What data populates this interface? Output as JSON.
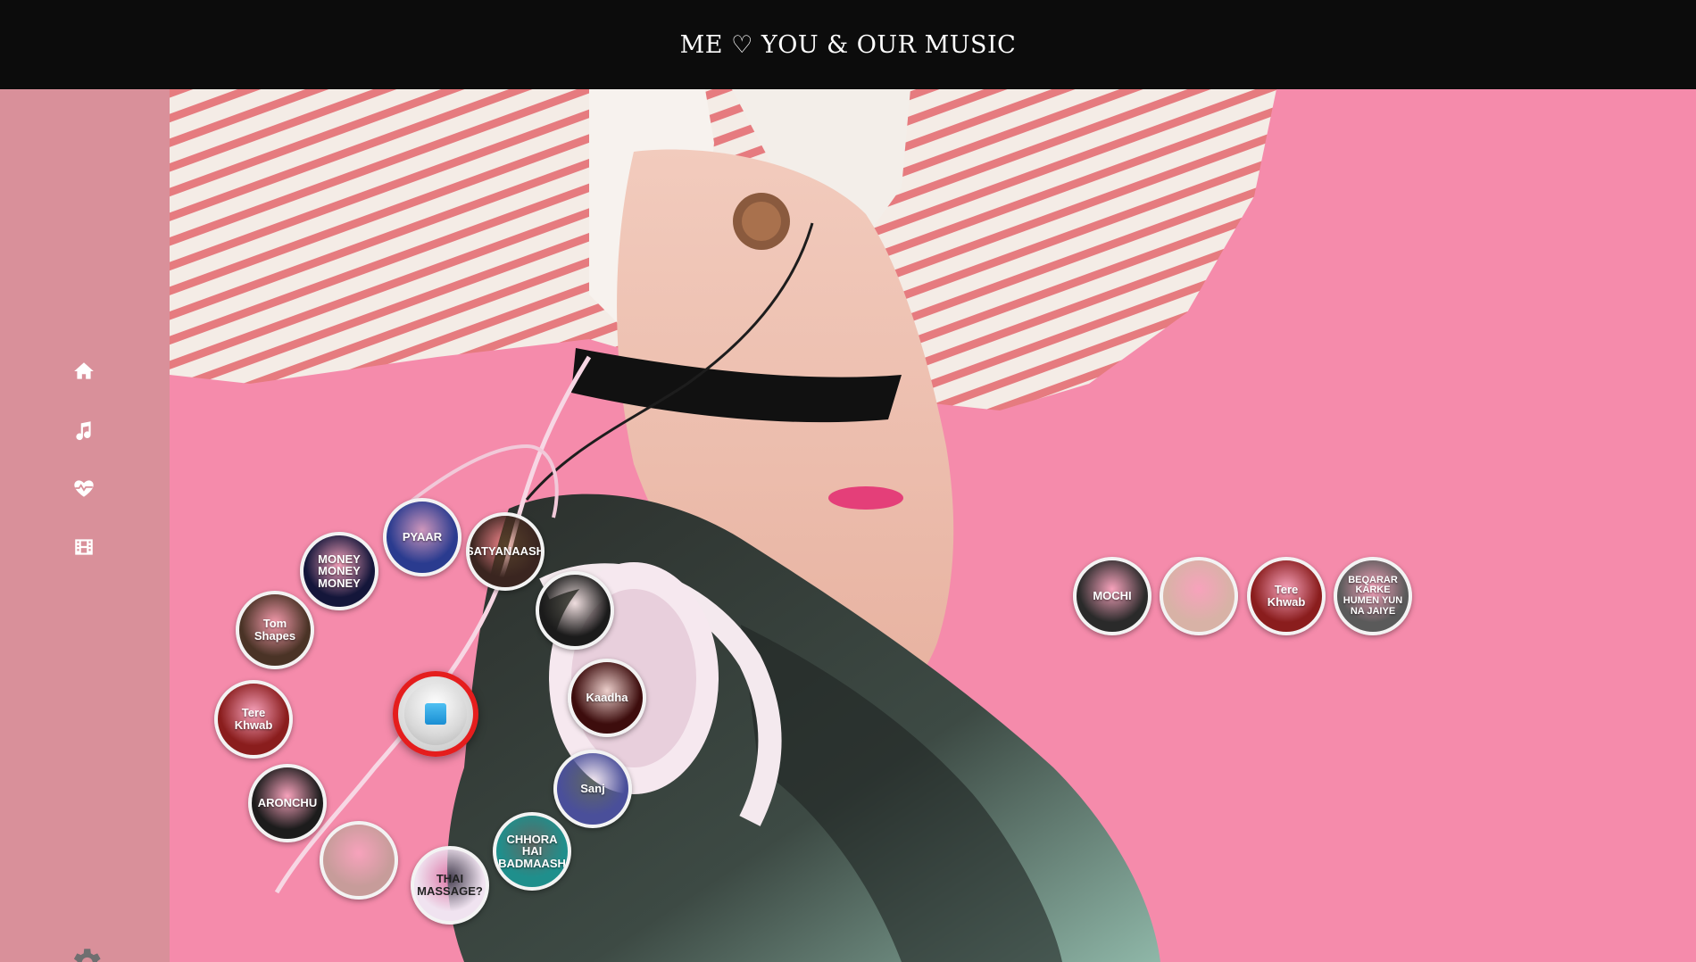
{
  "header": {
    "title": "ME ♡ YOU & OUR MUSIC"
  },
  "sidebar": {
    "items": [
      {
        "name": "home",
        "icon": "home-icon"
      },
      {
        "name": "music",
        "icon": "music-note-icon"
      },
      {
        "name": "favorites",
        "icon": "heart-pulse-icon"
      },
      {
        "name": "videos",
        "icon": "film-icon"
      }
    ],
    "settings_icon": "gear-icon"
  },
  "player": {
    "state_icon": "stop-icon",
    "accent": "#e51d1d"
  },
  "ring_discs": [
    {
      "label": "PYAAR",
      "bg": "#2a3b8f",
      "accent": "#35c6ff"
    },
    {
      "label": "MONEY MONEY MONEY",
      "bg": "#14163a",
      "accent": "#ffffff"
    },
    {
      "label": "SATYANAASH",
      "bg": "#3a2520",
      "accent": "#ff7a1a"
    },
    {
      "label": "Tom Shapes",
      "bg": "#4a3326",
      "accent": "#f1d7b0"
    },
    {
      "label": "",
      "bg": "#1b1b1b",
      "accent": "#d6b8a0"
    },
    {
      "label": "Kaadha",
      "bg": "#3d0d0d",
      "accent": "#ffd08a"
    },
    {
      "label": "Tere Khwab",
      "bg": "#8a1d1d",
      "accent": "#ffffff"
    },
    {
      "label": "Sanj",
      "bg": "#4a4f9a",
      "accent": "#ffffff"
    },
    {
      "label": "ARONCHU",
      "bg": "#1c1c1c",
      "accent": "#ffffff"
    },
    {
      "label": "CHHORA HAI BADMAASH",
      "bg": "#1f8f8c",
      "accent": "#ffffff"
    },
    {
      "label": "",
      "bg": "#c79c9a",
      "accent": "#ffffff"
    },
    {
      "label": "THAI MASSAGE?",
      "bg": "#f0e3f0",
      "accent": "#7a2d9a"
    }
  ],
  "queue_discs": [
    {
      "label": "MOCHI",
      "bg": "#2a2a2a",
      "accent": "#ffffff"
    },
    {
      "label": "",
      "bg": "#d8b2a6",
      "accent": "#ffffff"
    },
    {
      "label": "Tere Khwab",
      "bg": "#8a1d1d",
      "accent": "#ffffff"
    },
    {
      "label": "BEQARAR KARKE HUMEN YUN NA JAIYE",
      "bg": "#5a5a5a",
      "accent": "#ffffff"
    }
  ]
}
